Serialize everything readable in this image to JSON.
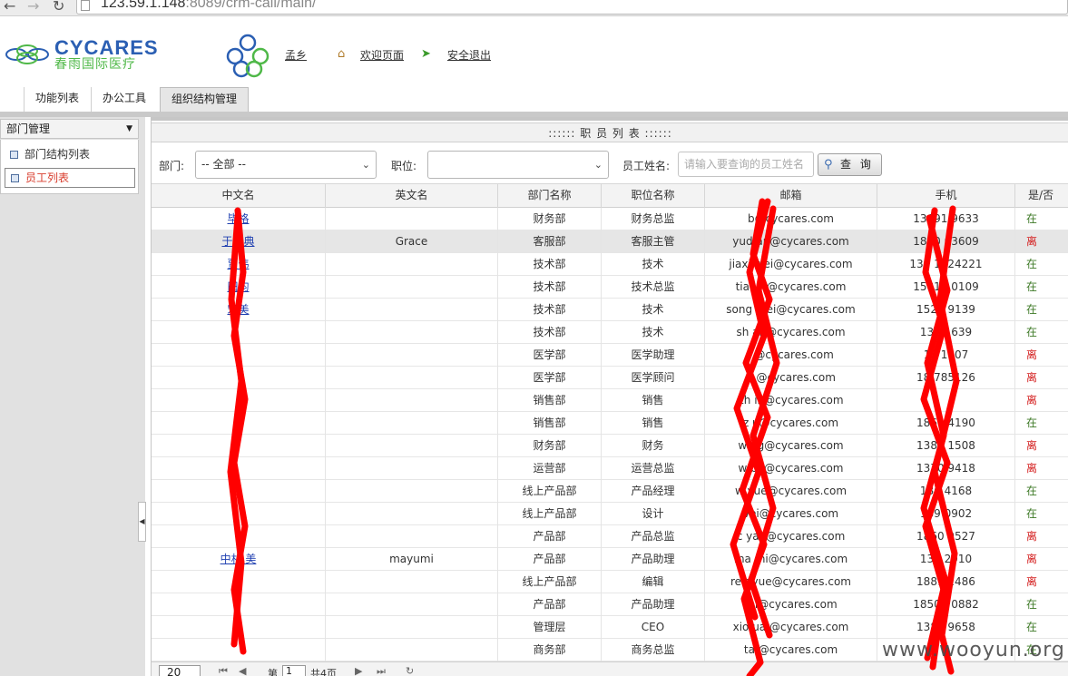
{
  "browser": {
    "url_host": "123.59.1.148",
    "url_rest": ":8089/crm-call/main/"
  },
  "header": {
    "logo_en": "CYCARES",
    "logo_cn": "春雨国际医疗",
    "user_name": "孟乡",
    "welcome_label": "欢迎页面",
    "logout_label": "安全退出"
  },
  "tabs": [
    {
      "label": "功能列表"
    },
    {
      "label": "办公工具"
    },
    {
      "label": "组织结构管理"
    }
  ],
  "sidebar": {
    "title": "部门管理",
    "items": [
      {
        "label": "部门结构列表"
      },
      {
        "label": "员工列表"
      }
    ]
  },
  "panel": {
    "title": "::::::  职 员 列 表  ::::::"
  },
  "filters": {
    "dept_label": "部门:",
    "dept_value": "-- 全部  --",
    "position_label": "职位:",
    "position_value": "",
    "name_label": "员工姓名:",
    "name_placeholder": "请输入要查询的员工姓名",
    "search_label": "查 询"
  },
  "table": {
    "columns": [
      "中文名",
      "英文名",
      "部门名称",
      "职位名称",
      "邮箱",
      "手机",
      "是/否"
    ],
    "rows": [
      {
        "cn": "毕格",
        "en": "",
        "dept": "财务部",
        "pos": "财务总监",
        "email": "b@cycares.com",
        "phone": "13691 9633",
        "status": "在"
      },
      {
        "cn": "于玲典",
        "en": "Grace",
        "dept": "客服部",
        "pos": "客服主管",
        "email": "yud an@cycares.com",
        "phone": "1800 03609",
        "status": "离"
      },
      {
        "cn": "贾伟",
        "en": "",
        "dept": "技术部",
        "pos": "技术",
        "email": "jiaxi wei@cycares.com",
        "phone": "139 1224221",
        "status": "在"
      },
      {
        "cn": "田均",
        "en": "",
        "dept": "技术部",
        "pos": "技术总监",
        "email": "tia un@cycares.com",
        "phone": "1581 10109",
        "status": "在"
      },
      {
        "cn": "宋美",
        "en": "",
        "dept": "技术部",
        "pos": "技术",
        "email": "song mei@cycares.com",
        "phone": "1521 9139",
        "status": "在"
      },
      {
        "cn": "",
        "en": "",
        "dept": "技术部",
        "pos": "技术",
        "email": "sh an@cycares.com",
        "phone": "138 1639",
        "status": "在"
      },
      {
        "cn": "",
        "en": "",
        "dept": "医学部",
        "pos": "医学助理",
        "email": "j @cycares.com",
        "phone": "18 1107",
        "status": "离"
      },
      {
        "cn": "",
        "en": "",
        "dept": "医学部",
        "pos": "医学顾问",
        "email": "u @cycares.com",
        "phone": "18 785126",
        "status": "离"
      },
      {
        "cn": "",
        "en": "",
        "dept": "销售部",
        "pos": "销售",
        "email": "zh in@cycares.com",
        "phone": "",
        "status": "离"
      },
      {
        "cn": "",
        "en": "",
        "dept": "销售部",
        "pos": "销售",
        "email": "z u@cycares.com",
        "phone": "1861 4190",
        "status": "在"
      },
      {
        "cn": "",
        "en": "",
        "dept": "财务部",
        "pos": "财务",
        "email": "w ng@cycares.com",
        "phone": "1381 1508",
        "status": "离"
      },
      {
        "cn": "",
        "en": "",
        "dept": "运营部",
        "pos": "运营总监",
        "email": "w bo@cycares.com",
        "phone": "1370 9418",
        "status": "离"
      },
      {
        "cn": "",
        "en": "",
        "dept": "线上产品部",
        "pos": "产品经理",
        "email": "w yue@cycares.com",
        "phone": "186 4168",
        "status": "在"
      },
      {
        "cn": "",
        "en": "",
        "dept": "线上产品部",
        "pos": "设计",
        "email": "vei@cycares.com",
        "phone": "189 0902",
        "status": "在"
      },
      {
        "cn": "",
        "en": "",
        "dept": "产品部",
        "pos": "产品总监",
        "email": "c yao@cycares.com",
        "phone": "1860 9527",
        "status": "离"
      },
      {
        "cn": "中村 美",
        "en": "mayumi",
        "dept": "产品部",
        "pos": "产品助理",
        "email": "ma mi@cycares.com",
        "phone": "138 2910",
        "status": "离"
      },
      {
        "cn": "",
        "en": "",
        "dept": "线上产品部",
        "pos": "编辑",
        "email": "re gyue@cycares.com",
        "phone": "1881 2486",
        "status": "离"
      },
      {
        "cn": "",
        "en": "",
        "dept": "产品部",
        "pos": "产品助理",
        "email": "fei@cycares.com",
        "phone": "1850 70882",
        "status": "在"
      },
      {
        "cn": "",
        "en": "",
        "dept": "管理层",
        "pos": "CEO",
        "email": "xio ua @cycares.com",
        "phone": "1380 9658",
        "status": "在"
      },
      {
        "cn": "",
        "en": "",
        "dept": "商务部",
        "pos": "商务总监",
        "email": "ta @cycares.com",
        "phone": "",
        "status": "在"
      }
    ]
  },
  "pager": {
    "page_size": "20",
    "page_prefix": "第",
    "page_value": "1",
    "page_total": "共4页"
  },
  "watermark": "www.wooyun.org",
  "colors": {
    "brand_blue": "#2b5fb3",
    "brand_green": "#4fb848",
    "link": "#1f3fb0",
    "status_on": "#3e7a27",
    "status_off": "#d41f1f",
    "redaction": "#ff0000"
  }
}
